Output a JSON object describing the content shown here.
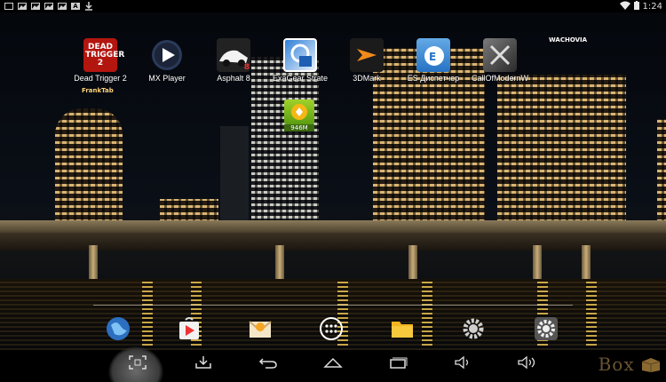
{
  "status_bar": {
    "notification_icons": [
      "screen-icon",
      "image-icon",
      "image-icon",
      "image-icon",
      "image-icon",
      "a-icon",
      "download-icon"
    ],
    "a_icon_letter": "A",
    "time": "1:24"
  },
  "desktop": {
    "apps": [
      {
        "label": "Dead Trigger 2",
        "icon": "dead-trigger-icon",
        "icon_text": "DEAD TRIGGER 2"
      },
      {
        "label": "MX Player",
        "icon": "mx-player-icon"
      },
      {
        "label": "Asphalt 8",
        "icon": "asphalt-icon",
        "icon_text": "8"
      },
      {
        "label": "ExaGear Strate",
        "icon": "exagear-icon"
      },
      {
        "label": "3DMark",
        "icon": "3dmark-icon"
      },
      {
        "label": "ES Диспетчер",
        "icon": "es-explorer-icon"
      },
      {
        "label": "CallOfModernW",
        "icon": "call-of-modern-icon"
      }
    ],
    "widget": {
      "icon": "memory-booster-icon",
      "text": "946M"
    }
  },
  "buildings_signs": {
    "left": "FrankTab",
    "right": "WACHOVIA"
  },
  "dock": {
    "items": [
      "browser-globe-icon",
      "play-store-icon",
      "email-icon",
      "app-drawer-icon",
      "file-manager-icon",
      "settings-icon",
      "settings-icon"
    ]
  },
  "nav_bar": {
    "items": [
      "screenshot-icon",
      "download-icon",
      "back-icon",
      "home-icon",
      "recent-apps-icon",
      "volume-down-icon",
      "volume-up-icon"
    ],
    "watermark": "Box"
  },
  "colors": {
    "statusbar_bg": "#000000",
    "navbar_bg": "#000000"
  }
}
